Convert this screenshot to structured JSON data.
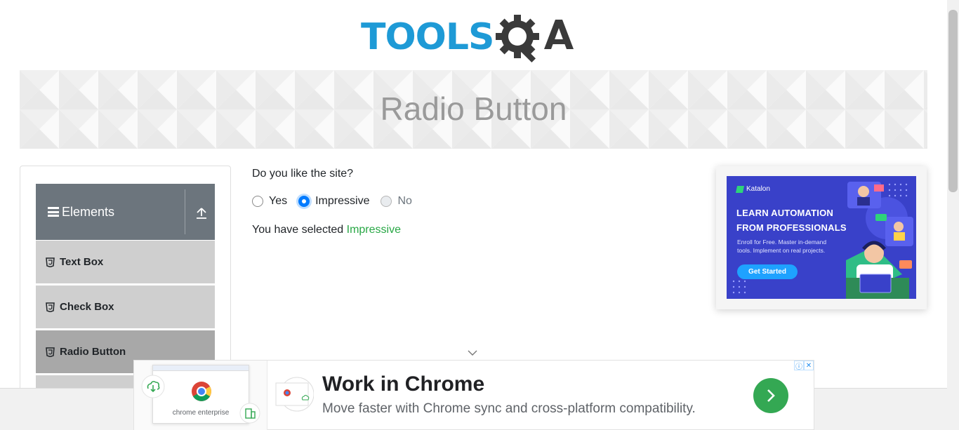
{
  "logo": {
    "part1": "TOOLS",
    "part2": "QA"
  },
  "banner": {
    "title": "Radio Button"
  },
  "sidebar": {
    "group_title": "Elements",
    "items": [
      {
        "label": "Text Box"
      },
      {
        "label": "Check Box"
      },
      {
        "label": "Radio Button"
      }
    ]
  },
  "main": {
    "question": "Do you like the site?",
    "options": [
      {
        "label": "Yes",
        "state": "unchecked"
      },
      {
        "label": "Impressive",
        "state": "checked"
      },
      {
        "label": "No",
        "state": "disabled"
      }
    ],
    "result_prefix": "You have selected ",
    "result_value": "Impressive"
  },
  "side_ad": {
    "brand": "Katalon",
    "headline_line1": "LEARN AUTOMATION",
    "headline_line2": "FROM PROFESSIONALS",
    "subtext": "Enroll for Free. Master in-demand tools. Implement on real projects.",
    "cta": "Get Started"
  },
  "bottom_ad": {
    "thumb_caption": "chrome enterprise",
    "title": "Work in Chrome",
    "description": "Move faster with Chrome sync and cross-platform compatibility."
  },
  "colors": {
    "brand_blue": "#1e9ad6",
    "brand_dark": "#3a3a3a",
    "selected_green": "#28a745",
    "radio_blue": "#007bff",
    "sidebar_header": "#6c757d",
    "ad_blue": "#3941c9"
  }
}
